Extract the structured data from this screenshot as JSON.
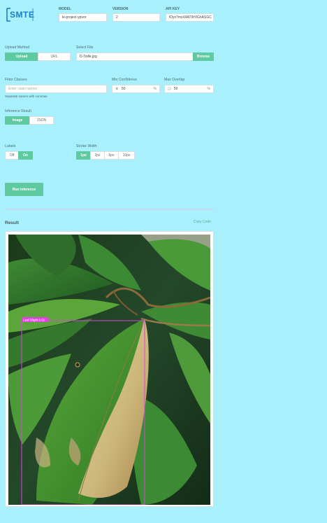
{
  "brand": {
    "logo_text": "SMTE"
  },
  "fields": {
    "model": {
      "label": "MODEL",
      "value": "le-project-ypvor"
    },
    "version": {
      "label": "VERSION",
      "value": "2"
    },
    "api_key": {
      "label": "API KEY",
      "value": "lOyv7mxX4AT9tYiGhASGC"
    }
  },
  "upload_method": {
    "label": "Upload Method",
    "options": [
      "Upload",
      "URL"
    ],
    "selected": "Upload"
  },
  "select_file": {
    "label": "Select File",
    "value": "D-Toille.jpg",
    "browse_label": "Browse"
  },
  "filter_classes": {
    "label": "Filter Classes",
    "placeholder": "Enter class names",
    "help": "Separate names with commas"
  },
  "min_confidence": {
    "label": "Min Confidence",
    "value": "50",
    "unit": "%"
  },
  "max_overlap": {
    "label": "Max Overlap",
    "value": "50",
    "unit": "%"
  },
  "inference_result": {
    "label": "Inference Result",
    "options": [
      "Image",
      "JSON"
    ],
    "selected": "Image"
  },
  "labels": {
    "label": "Labels",
    "options": [
      "Off",
      "On"
    ],
    "selected": "On"
  },
  "stroke_width": {
    "label": "Stroke Width",
    "options": [
      "1px",
      "2px",
      "5px",
      "10px"
    ],
    "selected": "1px"
  },
  "run_button": {
    "label": "Run Inference"
  },
  "result": {
    "title": "Result",
    "copy_code": "Copy Code",
    "detection_label": "Leaf Blight 0.91"
  },
  "colors": {
    "background": "#a8f0fb",
    "accent": "#5fc9a0",
    "box": "#e040e0"
  }
}
